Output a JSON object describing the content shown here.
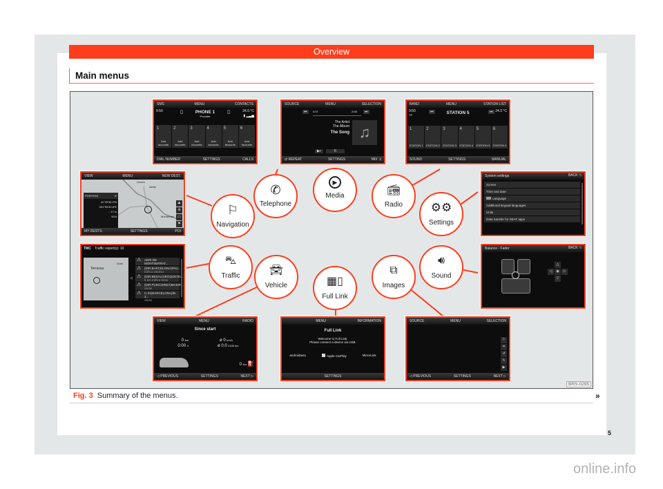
{
  "header": {
    "title": "Overview"
  },
  "section": {
    "title": "Main menus"
  },
  "figure": {
    "id": "BRS-0295",
    "caption_label": "Fig. 3",
    "caption_text": "Summary of the menus.",
    "continue_mark": "»"
  },
  "page_number": "5",
  "watermark": "online.info",
  "menus": {
    "telephone": "Telephone",
    "media": "Media",
    "radio": "Radio",
    "navigation": "Navigation",
    "settings": "Settings",
    "traffic": "Traffic",
    "vehicle": "Vehicle",
    "full_link": "Full Link",
    "images": "Images",
    "sound": "Sound"
  },
  "screens": {
    "phone": {
      "top": [
        "SMS",
        "MENU",
        "CONTACTS"
      ],
      "bottom": [
        "DIAL NUMBER",
        "SETTINGS",
        "CALLS"
      ],
      "time": "9:50",
      "title": "PHONE 1",
      "provider": "Provider",
      "temp": "24.0 °C",
      "favourites": [
        {
          "n": "1",
          "label": "Add favourite"
        },
        {
          "n": "2",
          "label": "Add favourite"
        },
        {
          "n": "3",
          "label": "Add favourite"
        },
        {
          "n": "4",
          "label": "Add favourite"
        },
        {
          "n": "5",
          "label": "Add favourite"
        },
        {
          "n": "6",
          "label": "Add favourite"
        }
      ]
    },
    "media": {
      "top": [
        "SOURCE",
        "MENU",
        "SELECTION"
      ],
      "bottom": [
        "REPEAT",
        "SETTINGS",
        "MIX"
      ],
      "elapsed": "0:07",
      "remaining": "-3:00",
      "artist": "The Artist",
      "album": "The Album",
      "song": "The Song",
      "pause": "II"
    },
    "radio": {
      "top": [
        "BAND",
        "MENU",
        "STATION LIST"
      ],
      "bottom": [
        "SOUND",
        "SETTINGS",
        "MANUAL"
      ],
      "time": "9:50",
      "tp": "TP",
      "station": "STATION 5",
      "temp": "24.0 °C",
      "presets": [
        {
          "n": "1",
          "label": "STATION 1"
        },
        {
          "n": "2",
          "label": "STATION 2"
        },
        {
          "n": "3",
          "label": "STATION 3"
        },
        {
          "n": "4",
          "label": "STATION 4"
        },
        {
          "n": "5",
          "label": "STATION 5"
        },
        {
          "n": "6",
          "label": "STATION 6"
        }
      ]
    },
    "navigation": {
      "top": [
        "VIEW",
        "MENU",
        "NEW DEST."
      ],
      "bottom": [
        "MY DESTS.",
        "SETTINGS",
        "POI"
      ],
      "panel_title": "POSITION",
      "lat": "41°29'30.0\"N",
      "lon": "001°53'40.8\"E",
      "alt": "- 17 m",
      "gps": "9/16",
      "places": [
        "Alella",
        "Llinars",
        "Montornès"
      ]
    },
    "system_settings": {
      "title": "System settings",
      "back": "BACK",
      "items": [
        "Screen",
        "Time and date",
        "Language",
        "Additional keypad languages",
        "Units",
        "Data transfer for SEAT apps"
      ]
    },
    "traffic": {
      "badge": "TMC",
      "title": "Traffic report(s): 10",
      "places": [
        "Terrassa",
        "Gran"
      ],
      "reports": [
        {
          "road": "AERI DE MONTSERRAT...",
          "info": "obras"
        },
        {
          "road": "(DIR.BARCELONA)PAU...",
          "info": "tráfico intenso"
        },
        {
          "road": "(DIR.BESALÚ)ROQUETES...",
          "info": "5 km tráfico lento"
        },
        {
          "road": "(DIR.PUIGCERDÀ)MASIR...",
          "info": "obras"
        },
        {
          "road": "C-31(BARCELONA)/B-2...",
          "info": "obras"
        }
      ]
    },
    "sound": {
      "title": "Balance - Fader",
      "back": "BACK"
    },
    "vehicle": {
      "top": [
        "VIEW",
        "MENU",
        "RADIO"
      ],
      "bottom": [
        "PREVIOUS",
        "SETTINGS",
        "NEXT"
      ],
      "title": "Since start",
      "distance": "0",
      "distance_unit": "km",
      "time": "0:00",
      "time_unit": "h",
      "avg_speed": "ø 0",
      "avg_speed_unit": "km/h",
      "avg_cons": "ø 0.0",
      "avg_cons_unit": "l/100 km",
      "range": "0",
      "range_unit": "km"
    },
    "full_link": {
      "top": [
        "",
        "MENU",
        "INFORMATION"
      ],
      "bottom": [
        "",
        "SETTINGS",
        ""
      ],
      "title": "Full Link",
      "line1": "Welcome to Full Link.",
      "line2": "Please connect a device via USB.",
      "options": [
        "androidauto",
        "Apple CarPlay",
        "MirrorLink"
      ]
    },
    "images": {
      "top": [
        "SOURCE",
        "MENU",
        "SELECTION"
      ],
      "bottom": [
        "PREVIOUS",
        "SETTINGS",
        "NEXT"
      ]
    }
  },
  "colors": {
    "accent": "#ff3c1c",
    "frame_bg": "#e4e7e8",
    "screen_bg": "#0d0d0d"
  }
}
